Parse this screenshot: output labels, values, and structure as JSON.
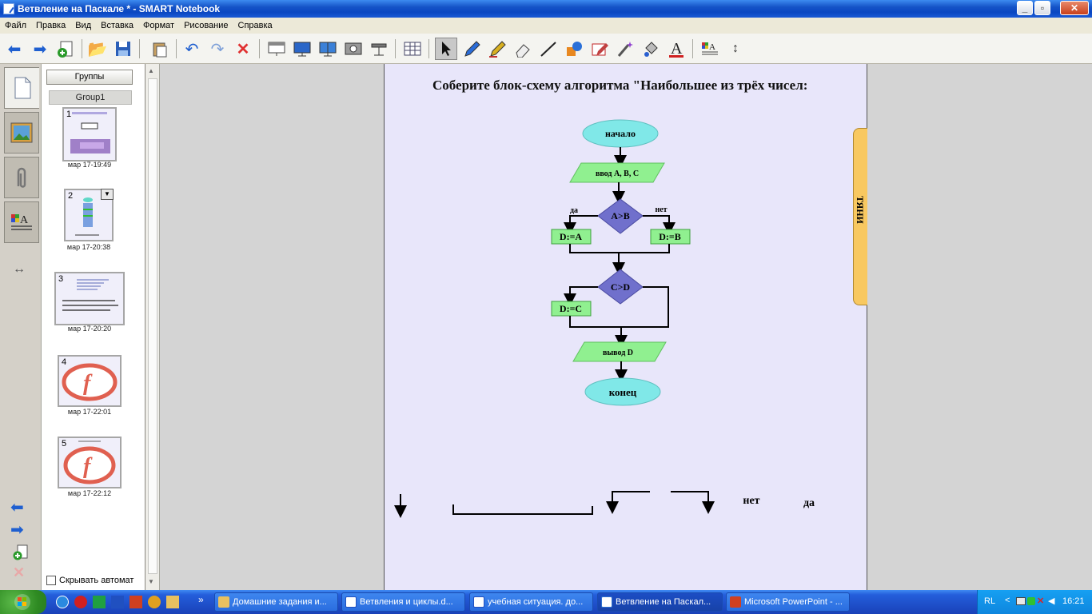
{
  "window": {
    "title": "Ветвление на Паскале * - SMART Notebook"
  },
  "menu": [
    "Файл",
    "Правка",
    "Вид",
    "Вставка",
    "Формат",
    "Рисование",
    "Справка"
  ],
  "sorter": {
    "groups_label": "Группы",
    "group_name": "Group1",
    "thumbs": [
      {
        "num": "1",
        "date": "мар 17-19:49"
      },
      {
        "num": "2",
        "date": "мар 17-20:38"
      },
      {
        "num": "3",
        "date": "мар 17-20:20"
      },
      {
        "num": "4",
        "date": "мар 17-22:01"
      },
      {
        "num": "5",
        "date": "мар 17-22:12"
      }
    ],
    "autohide_label": "Скрывать автомат"
  },
  "page": {
    "heading": "Соберите блок-схему алгоритма \"Наибольшее из трёх чисел:",
    "pull_tab": "ТЯНИ",
    "flow": {
      "start": "начало",
      "input": "ввод A, B, C",
      "cond1": "A>B",
      "yes1": "да",
      "no1": "нет",
      "assign_a": "D:=A",
      "assign_b": "D:=B",
      "cond2": "C>D",
      "assign_c": "D:=C",
      "output": "вывод D",
      "end": "конец"
    },
    "loose": {
      "no": "нет",
      "yes": "да"
    }
  },
  "taskbar": {
    "tasks": [
      "Домашние задания и...",
      "Ветвления и циклы.d...",
      "учебная ситуация. до...",
      "Ветвление на Паскал...",
      "Microsoft PowerPoint - ..."
    ],
    "lang": "RL",
    "clock": "16:21"
  },
  "colors": {
    "accent": "#0a47c2",
    "flow_oval": "#80e8e8",
    "flow_box": "#90f090",
    "flow_diamond": "#7070cc",
    "page_bg": "#e8e6fa"
  }
}
